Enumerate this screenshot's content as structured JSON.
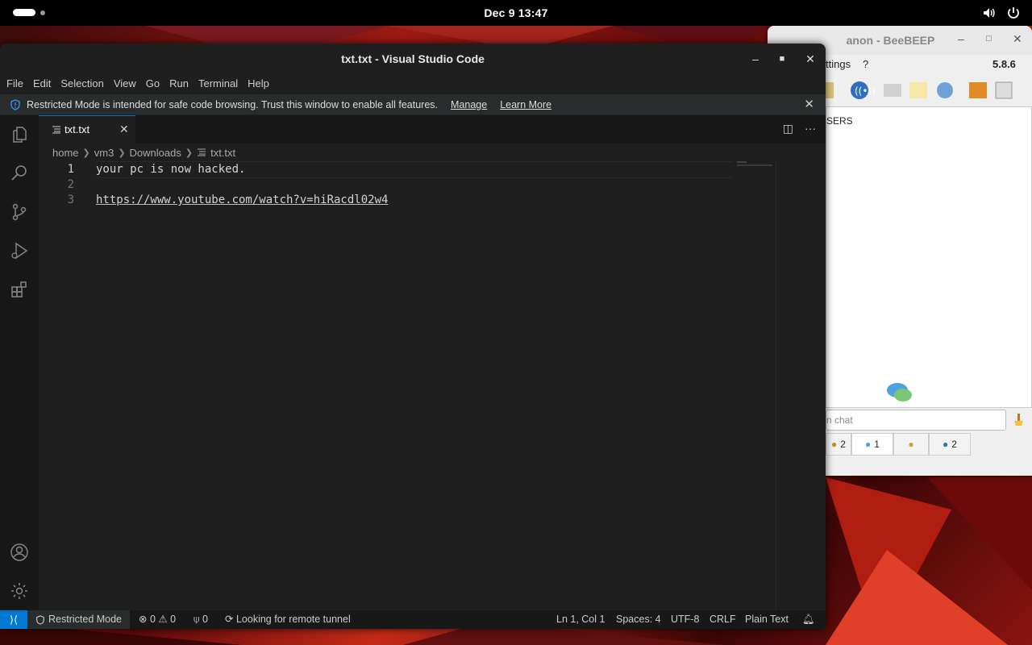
{
  "topbar": {
    "clock": "Dec 9  13:47",
    "icons": [
      "volume-icon",
      "power-icon"
    ]
  },
  "beebeep": {
    "title": "anon - BeeBEEP",
    "menu_partial": "ttings",
    "menu_help": "?",
    "version": "5.8.6",
    "panel_header": "SERS",
    "chat_placeholder": "n chat",
    "tabs": [
      {
        "icon": "users-icon",
        "count": "2"
      },
      {
        "icon": "chat-icon",
        "count": "1"
      },
      {
        "icon": "groups-icon",
        "count": ""
      },
      {
        "icon": "files-icon",
        "count": "2"
      }
    ]
  },
  "vscode": {
    "title": "txt.txt - Visual Studio Code",
    "menu": [
      "File",
      "Edit",
      "Selection",
      "View",
      "Go",
      "Run",
      "Terminal",
      "Help"
    ],
    "banner": {
      "message": "Restricted Mode is intended for safe code browsing. Trust this window to enable all features.",
      "manage": "Manage",
      "learn_more": "Learn More"
    },
    "tab": {
      "name": "txt.txt"
    },
    "breadcrumb": [
      "home",
      "vm3",
      "Downloads",
      "txt.txt"
    ],
    "lines": [
      {
        "num": "1",
        "text": "your pc is now hacked."
      },
      {
        "num": "2",
        "text": ""
      },
      {
        "num": "3",
        "text": "https://www.youtube.com/watch?v=hiRacdl02w4"
      }
    ],
    "statusbar": {
      "restricted": "Restricted Mode",
      "errors": "0",
      "warnings": "0",
      "ports": "0",
      "tunnel": "Looking for remote tunnel",
      "position": "Ln 1, Col 1",
      "spaces": "Spaces: 4",
      "encoding": "UTF-8",
      "eol": "CRLF",
      "language": "Plain Text"
    }
  },
  "colors": {
    "accent": "#0078d4",
    "editor_bg": "#1f1f1f",
    "sidebar_bg": "#181818"
  }
}
